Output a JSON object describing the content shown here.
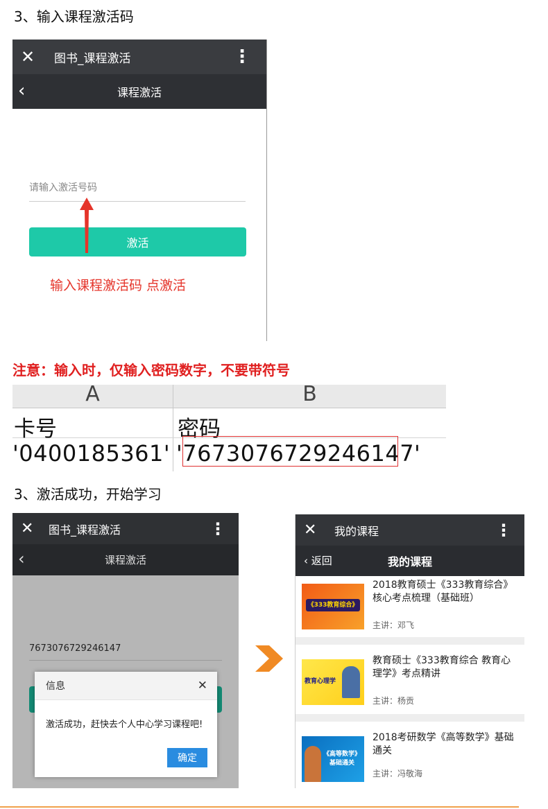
{
  "steps": {
    "step1": "3、输入课程激活码",
    "note": "注意：输入时，仅输入密码数字，不要带符号",
    "step2": "3、激活成功，开始学习"
  },
  "phone1": {
    "window_title": "图书_课程激活",
    "page_title": "课程激活",
    "input_placeholder": "请输入激活号码",
    "activate_button": "激活",
    "instruction": "输入课程激活码 点激活"
  },
  "sheet": {
    "columns": [
      "A",
      "B"
    ],
    "header": [
      "卡号",
      "密码"
    ],
    "row": [
      "'0400185361'",
      "'7673076729246147'"
    ],
    "highlight_value": "7673076729246147"
  },
  "phone2": {
    "window_title": "图书_课程激活",
    "page_title": "课程激活",
    "input_value": "7673076729246147",
    "dialog": {
      "title": "信息",
      "message": "激活成功，赶快去个人中心学习课程吧!",
      "confirm": "确定"
    }
  },
  "phone3": {
    "window_title": "我的课程",
    "back_label": "返回",
    "page_title": "我的课程",
    "courses": [
      {
        "title": "2018教育硕士《333教育综合》核心考点梳理（基础班）",
        "teacher": "主讲：邓飞",
        "thumb_text": "《333教育综合》"
      },
      {
        "title": "教育硕士《333教育综合 教育心理学》考点精讲",
        "teacher": "主讲：杨贡",
        "thumb_text": "教育心理学"
      },
      {
        "title": "2018考研数学《高等数学》基础通关",
        "teacher": "主讲：冯敬海",
        "thumb_text": "《高等数学》基础通关"
      }
    ]
  },
  "colors": {
    "accent": "#1ec9a8",
    "alert_red": "#e02020",
    "bar_dark": "#3a3c40",
    "confirm_blue": "#2a8ce0"
  }
}
